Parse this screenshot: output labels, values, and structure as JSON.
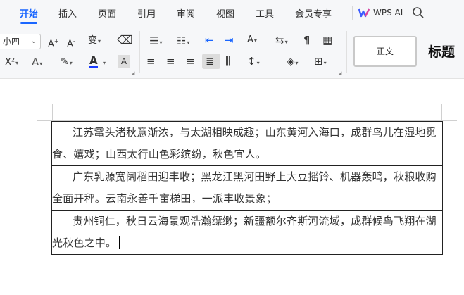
{
  "menubar": {
    "tabs": [
      {
        "label": "开始",
        "active": true
      },
      {
        "label": "插入"
      },
      {
        "label": "页面"
      },
      {
        "label": "引用"
      },
      {
        "label": "审阅"
      },
      {
        "label": "视图"
      },
      {
        "label": "工具"
      },
      {
        "label": "会员专享"
      }
    ],
    "ai_label": "WPS AI",
    "accent_color": "#1a66ff"
  },
  "toolbar": {
    "font_size_value": "小四",
    "font_color": "#1a3cff",
    "styles": {
      "normal": "正文",
      "title": "标题"
    }
  },
  "document": {
    "rows": [
      "江苏鼋头渚秋意渐浓，与太湖相映成趣；山东黄河入海口，成群鸟儿在湿地觅食、嬉戏；山西太行山色彩缤纷，秋色宜人。",
      "广东乳源宽阔稻田迎丰收；黑龙江黑河田野上大豆摇铃、机器轰鸣，秋粮收购全面开秤。云南永善千亩梯田，一派丰收景象；",
      "贵州铜仁，秋日云海景观浩瀚缥缈；新疆额尔齐斯河流域，成群候鸟飞翔在湖光秋色之中。"
    ]
  }
}
